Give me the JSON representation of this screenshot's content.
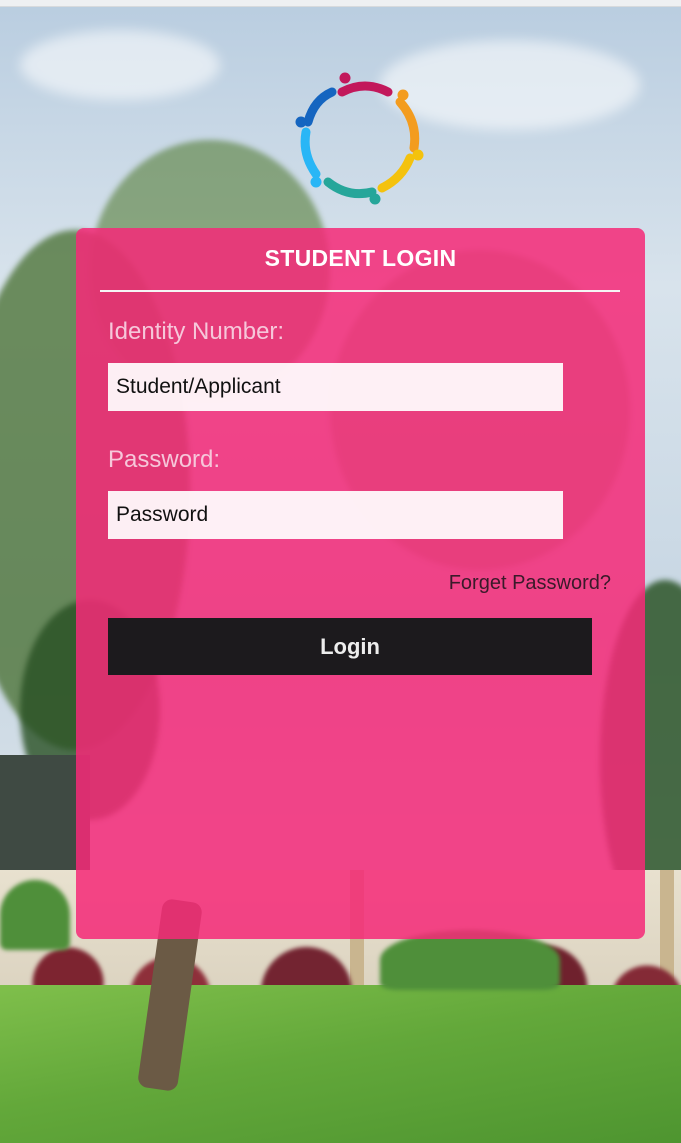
{
  "login": {
    "title": "STUDENT LOGIN",
    "identity_label": "Identity Number:",
    "identity_placeholder": "Student/Applicant",
    "password_label": "Password:",
    "password_placeholder": "Password",
    "forgot_link": "Forget Password?",
    "login_button": "Login"
  },
  "colors": {
    "card_background": "#f52a78",
    "button_background": "#1c1a1d",
    "logo_colors": [
      "#c2185b",
      "#f39c1f",
      "#f4c20d",
      "#26a69a",
      "#29b6f6",
      "#1565c0"
    ]
  },
  "icons": {
    "logo": "people-circle-logo"
  }
}
